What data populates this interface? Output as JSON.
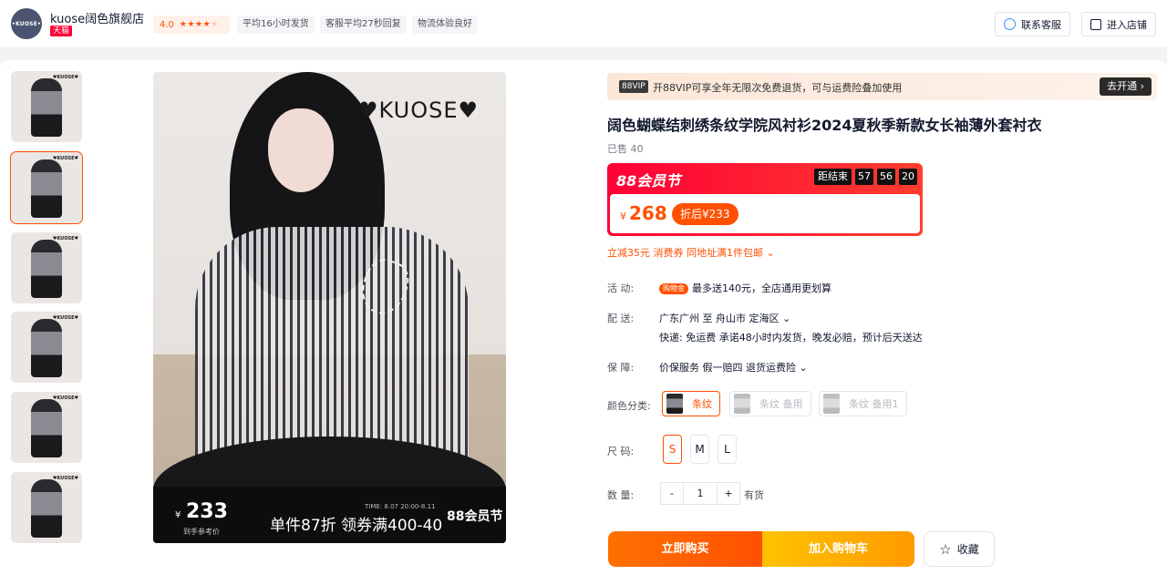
{
  "shop": {
    "name": "kuose阔色旗舰店",
    "logo_text": "•KUOSE•",
    "badge": "天猫",
    "rating": "4.0",
    "tags": [
      "平均16小时发货",
      "客服平均27秒回复",
      "物流体验良好"
    ],
    "contact_label": "联系客服",
    "enter_label": "进入店铺"
  },
  "gallery": {
    "brand": "♥KUOSE♥",
    "promo_price": "233",
    "promo_yen": "¥",
    "promo_ref": "到手参考价",
    "promo_time": "TIME: 8.07 20:00-8.11",
    "promo_deal": "单件87折 领券满400-40",
    "promo_fest": "88会员节",
    "thumb_logo": "♥KUOSE♥"
  },
  "vip": {
    "badge": "88VIP",
    "text": "开88VIP可享全年无限次免费退货，可与运费险叠加使用",
    "button": "去开通 ›"
  },
  "product": {
    "title": "阔色蝴蝶结刺绣条纹学院风衬衫2024夏秋季新款女长袖薄外套衬衣",
    "sold": "已售 40",
    "fest_title": "88会员节",
    "countdown_label": "距结束",
    "countdown": [
      "57",
      "56",
      "20"
    ],
    "yen": "¥",
    "price": "268",
    "after_price": "折后¥233",
    "coupon": "立减35元 消费券 同地址满1件包邮 ⌄"
  },
  "rows": {
    "activity_label": "活    动:",
    "activity_badge": "购物金",
    "activity_text": "最多送140元，全店通用更划算",
    "ship_label": "配    送:",
    "ship_text": "广东广州   至   舟山市 定海区 ⌄",
    "ship_sub": "快递: 免运费  承诺48小时内发货，晚发必赔，预计后天送达",
    "guarantee_label": "保    障:",
    "guarantee_text": "价保服务  假一赔四  退货运费险 ⌄",
    "color_label": "颜色分类:",
    "colors": [
      "条纹",
      "条纹 备用",
      "条纹 备用1"
    ],
    "size_label": "尺    码:",
    "sizes": [
      "S",
      "M",
      "L"
    ],
    "qty_label": "数    量:",
    "qty_minus": "-",
    "qty_value": "1",
    "qty_plus": "+",
    "stock": "有货"
  },
  "actions": {
    "buy_now": "立即购买",
    "add_cart": "加入购物车",
    "favorite": "收藏"
  }
}
